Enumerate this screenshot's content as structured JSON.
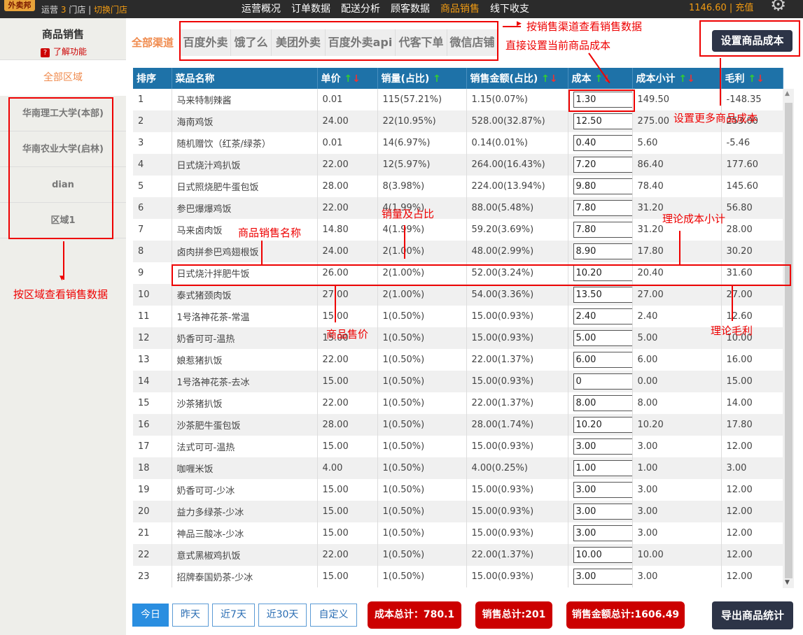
{
  "topbar": {
    "logo": "外卖邦",
    "shop_prefix": "运营",
    "shop_count": "3",
    "shop_suffix": "门店",
    "separator": "|",
    "switch_label": "切换门店",
    "nav": [
      "运营概况",
      "订单数据",
      "配送分析",
      "顾客数据",
      "商品销售",
      "线下收支"
    ],
    "active_nav": "商品销售",
    "balance": "1146.60 | 充值"
  },
  "sidebar": {
    "title": "商品销售",
    "help": "了解功能",
    "all_regions": "全部区域",
    "regions": [
      "华南理工大学(本部)",
      "华南农业大学(启林)",
      "dian",
      "区域1"
    ]
  },
  "channels": [
    "全部渠道",
    "百度外卖",
    "饿了么",
    "美团外卖",
    "百度外卖api",
    "代客下单",
    "微信店铺"
  ],
  "set_cost_button": "设置商品成本",
  "table": {
    "headers": [
      "排序",
      "菜品名称",
      "单价",
      "销量(占比)",
      "销售金额(占比)",
      "成本",
      "成本小计",
      "毛利"
    ],
    "rows": [
      [
        "1",
        "马来特制辣酱",
        "0.01",
        "115(57.21%)",
        "1.15(0.07%)",
        "1.30",
        "149.50",
        "-148.35"
      ],
      [
        "2",
        "海南鸡饭",
        "24.00",
        "22(10.95%)",
        "528.00(32.87%)",
        "12.50",
        "275.00",
        "253.00"
      ],
      [
        "3",
        "随机赠饮（红茶/绿茶）",
        "0.01",
        "14(6.97%)",
        "0.14(0.01%)",
        "0.40",
        "5.60",
        "-5.46"
      ],
      [
        "4",
        "日式烧汁鸡扒饭",
        "22.00",
        "12(5.97%)",
        "264.00(16.43%)",
        "7.20",
        "86.40",
        "177.60"
      ],
      [
        "5",
        "日式照烧肥牛蛋包饭",
        "28.00",
        "8(3.98%)",
        "224.00(13.94%)",
        "9.80",
        "78.40",
        "145.60"
      ],
      [
        "6",
        "参巴爆爆鸡饭",
        "22.00",
        "4(1.99%)",
        "88.00(5.48%)",
        "7.80",
        "31.20",
        "56.80"
      ],
      [
        "7",
        "马来卤肉饭",
        "14.80",
        "4(1.99%)",
        "59.20(3.69%)",
        "7.80",
        "31.20",
        "28.00"
      ],
      [
        "8",
        "卤肉拼参巴鸡翅根饭",
        "24.00",
        "2(1.00%)",
        "48.00(2.99%)",
        "8.90",
        "17.80",
        "30.20"
      ],
      [
        "9",
        "日式烧汁拌肥牛饭",
        "26.00",
        "2(1.00%)",
        "52.00(3.24%)",
        "10.20",
        "20.40",
        "31.60"
      ],
      [
        "10",
        "泰式猪颈肉饭",
        "27.00",
        "2(1.00%)",
        "54.00(3.36%)",
        "13.50",
        "27.00",
        "27.00"
      ],
      [
        "11",
        "1号洛神花茶-常温",
        "15.00",
        "1(0.50%)",
        "15.00(0.93%)",
        "2.40",
        "2.40",
        "12.60"
      ],
      [
        "12",
        "奶香可可-温热",
        "15.00",
        "1(0.50%)",
        "15.00(0.93%)",
        "5.00",
        "5.00",
        "10.00"
      ],
      [
        "13",
        "娘惹猪扒饭",
        "22.00",
        "1(0.50%)",
        "22.00(1.37%)",
        "6.00",
        "6.00",
        "16.00"
      ],
      [
        "14",
        "1号洛神花茶-去冰",
        "15.00",
        "1(0.50%)",
        "15.00(0.93%)",
        "0",
        "0.00",
        "15.00"
      ],
      [
        "15",
        "沙茶猪扒饭",
        "22.00",
        "1(0.50%)",
        "22.00(1.37%)",
        "8.00",
        "8.00",
        "14.00"
      ],
      [
        "16",
        "沙茶肥牛蛋包饭",
        "28.00",
        "1(0.50%)",
        "28.00(1.74%)",
        "10.20",
        "10.20",
        "17.80"
      ],
      [
        "17",
        "法式可可-温热",
        "15.00",
        "1(0.50%)",
        "15.00(0.93%)",
        "3.00",
        "3.00",
        "12.00"
      ],
      [
        "18",
        "咖喱米饭",
        "4.00",
        "1(0.50%)",
        "4.00(0.25%)",
        "1.00",
        "1.00",
        "3.00"
      ],
      [
        "19",
        "奶香可可-少冰",
        "15.00",
        "1(0.50%)",
        "15.00(0.93%)",
        "3.00",
        "3.00",
        "12.00"
      ],
      [
        "20",
        "益力多绿茶-少冰",
        "15.00",
        "1(0.50%)",
        "15.00(0.93%)",
        "3.00",
        "3.00",
        "12.00"
      ],
      [
        "21",
        "神品三酸冰-少冰",
        "15.00",
        "1(0.50%)",
        "15.00(0.93%)",
        "3.00",
        "3.00",
        "12.00"
      ],
      [
        "22",
        "意式黑椒鸡扒饭",
        "22.00",
        "1(0.50%)",
        "22.00(1.37%)",
        "10.00",
        "10.00",
        "12.00"
      ],
      [
        "23",
        "招牌泰国奶茶-少冰",
        "15.00",
        "1(0.50%)",
        "15.00(0.93%)",
        "3.00",
        "3.00",
        "12.00"
      ]
    ]
  },
  "footer": {
    "date_buttons": [
      "今日",
      "昨天",
      "近7天",
      "近30天",
      "自定义"
    ],
    "active_date": "今日",
    "cost_total": "成本总计：780.1",
    "sales_total": "销售总计:201",
    "amount_total": "销售金额总计:1606.49",
    "export_button": "导出商品统计"
  },
  "annotations": {
    "channel": "按销售渠道查看销售数据",
    "set_current": "直接设置当前商品成本",
    "set_more": "设置更多商品成本",
    "sales_ratio": "销量及占比",
    "product_name": "商品销售名称",
    "cost_subtotal": "理论成本小计",
    "unit_price": "商品售价",
    "gross_profit": "理论毛利",
    "region": "按区域查看销售数据"
  },
  "colors": {
    "header_blue": "#1e72a8",
    "accent_orange": "#f08b4e",
    "dark_button": "#2d3447",
    "total_red": "#cc0000",
    "annotation_red": "#ee0000"
  }
}
